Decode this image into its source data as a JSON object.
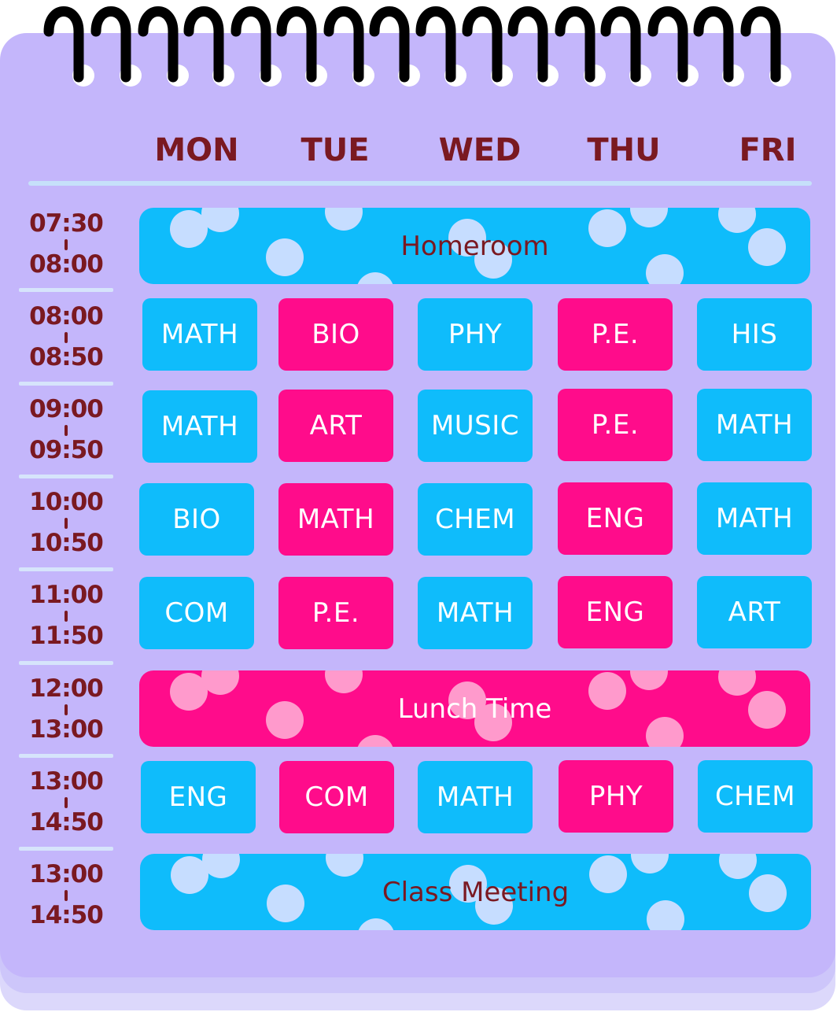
{
  "colors": {
    "sheet": "#c4b6fb",
    "blue_block": "#0fbcfb",
    "pink_block": "#ff0c8b",
    "heading_text": "#7a1921",
    "dots_on_blue": "#c6ddff",
    "dots_on_pink": "#ff9acc"
  },
  "icons": {
    "binding": "spiral-binding-rings"
  },
  "days": [
    "MON",
    "TUE",
    "WED",
    "THU",
    "FRI"
  ],
  "times": [
    {
      "start": "07:30",
      "end": "08:00"
    },
    {
      "start": "08:00",
      "end": "08:50"
    },
    {
      "start": "09:00",
      "end": "09:50"
    },
    {
      "start": "10:00",
      "end": "10:50"
    },
    {
      "start": "11:00",
      "end": "11:50"
    },
    {
      "start": "12:00",
      "end": "13:00"
    },
    {
      "start": "13:00",
      "end": "14:50"
    },
    {
      "start": "13:00",
      "end": "14:50"
    }
  ],
  "bands": {
    "homeroom": "Homeroom",
    "lunch": "Lunch Time",
    "class_meeting": "Class Meeting"
  },
  "periods": [
    [
      "MATH",
      "BIO",
      "PHY",
      "P.E.",
      "HIS"
    ],
    [
      "MATH",
      "ART",
      "MUSIC",
      "P.E.",
      "MATH"
    ],
    [
      "BIO",
      "MATH",
      "CHEM",
      "ENG",
      "MATH"
    ],
    [
      "COM",
      "P.E.",
      "MATH",
      "ENG",
      "ART"
    ],
    [
      "ENG",
      "COM",
      "MATH",
      "PHY",
      "CHEM"
    ]
  ]
}
